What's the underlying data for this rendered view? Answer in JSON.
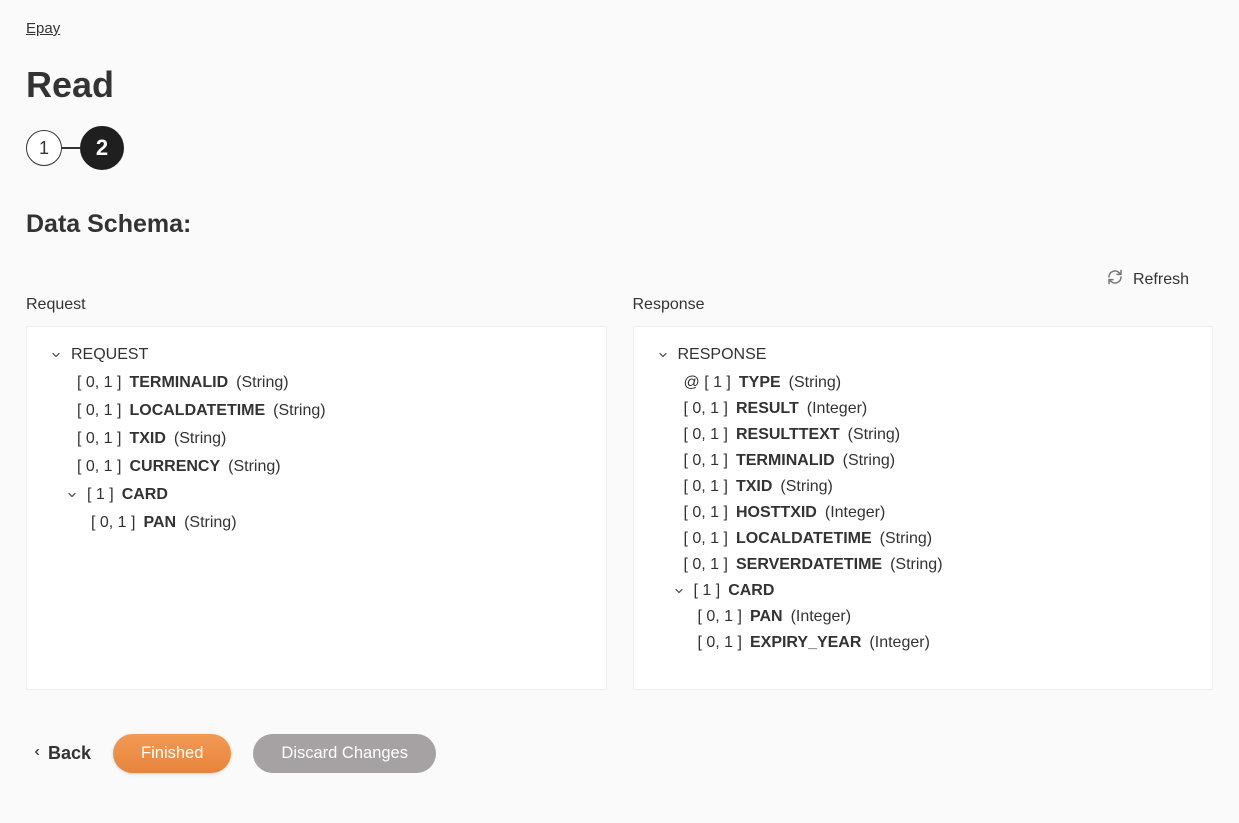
{
  "breadcrumb": "Epay",
  "title": "Read",
  "stepper": {
    "step1": "1",
    "step2": "2"
  },
  "sectionHeading": "Data Schema:",
  "refreshLabel": "Refresh",
  "request": {
    "label": "Request",
    "root": "REQUEST",
    "fields": [
      {
        "card": "[ 0, 1 ]",
        "name": "TERMINALID",
        "type": "(String)"
      },
      {
        "card": "[ 0, 1 ]",
        "name": "LOCALDATETIME",
        "type": "(String)"
      },
      {
        "card": "[ 0, 1 ]",
        "name": "TXID",
        "type": "(String)"
      },
      {
        "card": "[ 0, 1 ]",
        "name": "CURRENCY",
        "type": "(String)"
      }
    ],
    "sub": {
      "card": "[ 1 ]",
      "name": "CARD",
      "fields": [
        {
          "card": "[ 0, 1 ]",
          "name": "PAN",
          "type": "(String)"
        }
      ]
    }
  },
  "response": {
    "label": "Response",
    "root": "RESPONSE",
    "attr": {
      "card": "@ [ 1 ]",
      "name": "TYPE",
      "type": "(String)"
    },
    "fields": [
      {
        "card": "[ 0, 1 ]",
        "name": "RESULT",
        "type": "(Integer)"
      },
      {
        "card": "[ 0, 1 ]",
        "name": "RESULTTEXT",
        "type": "(String)"
      },
      {
        "card": "[ 0, 1 ]",
        "name": "TERMINALID",
        "type": "(String)"
      },
      {
        "card": "[ 0, 1 ]",
        "name": "TXID",
        "type": "(String)"
      },
      {
        "card": "[ 0, 1 ]",
        "name": "HOSTTXID",
        "type": "(Integer)"
      },
      {
        "card": "[ 0, 1 ]",
        "name": "LOCALDATETIME",
        "type": "(String)"
      },
      {
        "card": "[ 0, 1 ]",
        "name": "SERVERDATETIME",
        "type": "(String)"
      }
    ],
    "sub": {
      "card": "[ 1 ]",
      "name": "CARD",
      "fields": [
        {
          "card": "[ 0, 1 ]",
          "name": "PAN",
          "type": "(Integer)"
        },
        {
          "card": "[ 0, 1 ]",
          "name": "EXPIRY_YEAR",
          "type": "(Integer)"
        }
      ]
    }
  },
  "footer": {
    "back": "Back",
    "finished": "Finished",
    "discard": "Discard Changes"
  }
}
